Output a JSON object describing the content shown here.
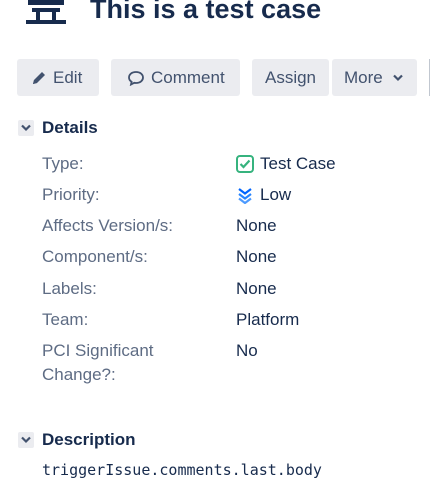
{
  "issue": {
    "title": "This is a test case"
  },
  "toolbar": {
    "edit_label": "Edit",
    "comment_label": "Comment",
    "assign_label": "Assign",
    "more_label": "More"
  },
  "details": {
    "heading": "Details",
    "fields": {
      "type": {
        "label": "Type:",
        "value": "Test Case"
      },
      "priority": {
        "label": "Priority:",
        "value": "Low"
      },
      "affects_version": {
        "label": "Affects Version/s:",
        "value": "None"
      },
      "components": {
        "label": "Component/s:",
        "value": "None"
      },
      "labels": {
        "label": "Labels:",
        "value": "None"
      },
      "team": {
        "label": "Team:",
        "value": "Platform"
      },
      "pci": {
        "label_line1": "PCI Significant",
        "label_line2": "Change?:",
        "value": "No"
      }
    }
  },
  "description": {
    "heading": "Description",
    "body": "triggerIssue.comments.last.body"
  },
  "colors": {
    "text": "#172b4d",
    "label": "#5e6c84",
    "button_bg": "#ebecf0",
    "test_case_icon": "#36b37e",
    "priority_low": "#0065ff"
  },
  "icons": {
    "project": "project-bench-icon",
    "edit": "pencil-icon",
    "comment": "speech-bubble-icon",
    "more": "chevron-down-icon",
    "type": "checkbox-icon",
    "priority": "priority-low-icon"
  }
}
